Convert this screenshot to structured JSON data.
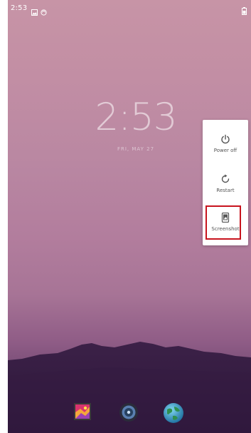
{
  "status_bar": {
    "time": "2:53",
    "left_icons": [
      "image-notification-icon",
      "sync-icon"
    ],
    "right_icons": [
      "battery-icon"
    ]
  },
  "lockscreen": {
    "clock": "2:53",
    "date": "FRI, MAY 27"
  },
  "power_menu": {
    "items": [
      {
        "label": "Power off",
        "icon": "power-icon"
      },
      {
        "label": "Restart",
        "icon": "restart-icon"
      },
      {
        "label": "Screenshot",
        "icon": "screenshot-icon"
      }
    ],
    "highlighted": "Screenshot",
    "highlight_color": "#c8141e"
  },
  "dock": {
    "apps": [
      {
        "icon": "gallery-icon"
      },
      {
        "icon": "music-icon"
      },
      {
        "icon": "browser-icon"
      }
    ]
  }
}
